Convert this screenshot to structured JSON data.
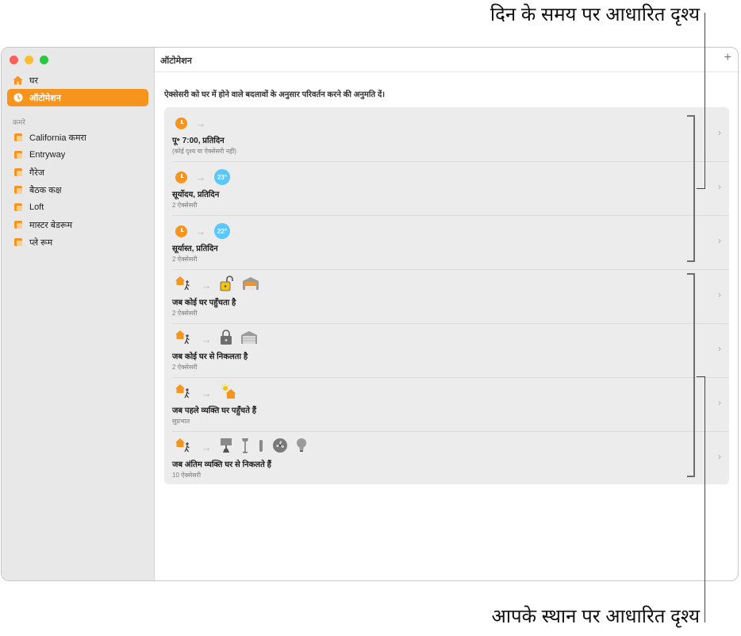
{
  "callouts": {
    "top": "दिन के समय पर आधारित दृश्य",
    "bottom": "आपके स्थान पर आधारित दृश्य"
  },
  "sidebar": {
    "home": "घर",
    "automation": "ऑटोमेशन",
    "rooms_header": "कमरे",
    "rooms": [
      "California कमरा",
      "Entryway",
      "गैरेज",
      "बैठक कक्ष",
      "Loft",
      "मास्टर बेडरूम",
      "प्ले रूम"
    ]
  },
  "main": {
    "title": "ऑटोमेशन",
    "add": "+",
    "description": "ऐक्सेसरी को घर में होने वाले बदलावों के अनुसार परिवर्तन करने की अनुमति दें।"
  },
  "automations": [
    {
      "title": "पू॰ 7:00, प्रतिदिन",
      "subtitle": "(कोई दृश्य या ऐक्सेसरी नहीं)",
      "temp": ""
    },
    {
      "title": "सूर्योदय, प्रतिदिन",
      "subtitle": "2 ऐक्सेसरी",
      "temp": "23°"
    },
    {
      "title": "सूर्यास्त, प्रतिदिन",
      "subtitle": "2 ऐक्सेसरी",
      "temp": "22°"
    },
    {
      "title": "जब कोई घर पहुँचता है",
      "subtitle": "2 ऐक्सेसरी",
      "temp": ""
    },
    {
      "title": "जब कोई घर से निकलता है",
      "subtitle": "2 ऐक्सेसरी",
      "temp": ""
    },
    {
      "title": "जब पहले व्यक्ति घर पहुँचते हैं",
      "subtitle": "सुप्रभात",
      "temp": ""
    },
    {
      "title": "जब अंतिम व्यक्ति घर से निकलते हैं",
      "subtitle": "10 ऐक्सेसरी",
      "temp": ""
    }
  ],
  "colors": {
    "accent": "#f7941d",
    "temp_badge": "#5ac8fa"
  }
}
